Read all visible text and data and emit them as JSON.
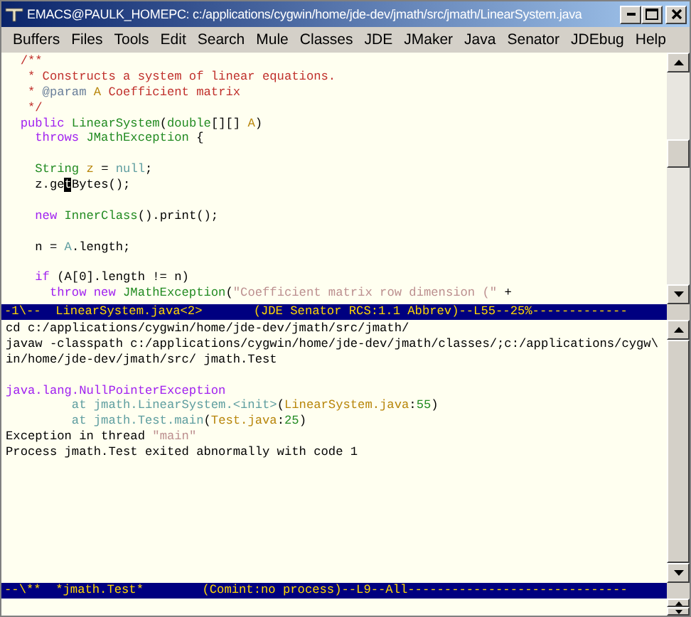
{
  "window": {
    "title": "EMACS@PAULK_HOMEPC: c:/applications/cygwin/home/jde-dev/jmath/src/jmath/LinearSystem.java"
  },
  "menu": [
    "Buffers",
    "Files",
    "Tools",
    "Edit",
    "Search",
    "Mule",
    "Classes",
    "JDE",
    "JMaker",
    "Java",
    "Senator",
    "JDEbug",
    "Help"
  ],
  "editor": {
    "lines": [
      {
        "kind": "code",
        "tokens": [
          {
            "text": "  /**",
            "kind": "comment"
          }
        ]
      },
      {
        "kind": "code",
        "tokens": [
          {
            "text": "   * Constructs a system of linear equations.",
            "kind": "comment"
          }
        ]
      },
      {
        "kind": "code",
        "tokens": [
          {
            "text": "   * ",
            "kind": "comment"
          },
          {
            "text": "@param ",
            "kind": "doctag"
          },
          {
            "text": "A",
            "kind": "variable"
          },
          {
            "text": " Coefficient matrix",
            "kind": "comment"
          }
        ]
      },
      {
        "kind": "code",
        "tokens": [
          {
            "text": "   */",
            "kind": "comment"
          }
        ]
      },
      {
        "kind": "code",
        "tokens": [
          {
            "text": "  public ",
            "kind": "keyword"
          },
          {
            "text": "LinearSystem",
            "kind": "type"
          },
          {
            "text": "(",
            "kind": "plain"
          },
          {
            "text": "double",
            "kind": "type"
          },
          {
            "text": "[][] ",
            "kind": "plain"
          },
          {
            "text": "A",
            "kind": "variable"
          },
          {
            "text": ")",
            "kind": "plain"
          }
        ]
      },
      {
        "kind": "code",
        "tokens": [
          {
            "text": "    throws ",
            "kind": "keyword"
          },
          {
            "text": "JMathException",
            "kind": "type"
          },
          {
            "text": " {",
            "kind": "plain"
          }
        ]
      },
      {
        "kind": "blank"
      },
      {
        "kind": "code",
        "tokens": [
          {
            "text": "    String ",
            "kind": "type"
          },
          {
            "text": "z",
            "kind": "variable"
          },
          {
            "text": " = ",
            "kind": "plain"
          },
          {
            "text": "null",
            "kind": "constant"
          },
          {
            "text": ";",
            "kind": "plain"
          }
        ]
      },
      {
        "kind": "code",
        "tokens": [
          {
            "text": "    z.ge",
            "kind": "plain"
          },
          {
            "text": "t",
            "kind": "cursor"
          },
          {
            "text": "Bytes();",
            "kind": "plain"
          }
        ]
      },
      {
        "kind": "blank"
      },
      {
        "kind": "code",
        "tokens": [
          {
            "text": "    new ",
            "kind": "keyword"
          },
          {
            "text": "InnerClass",
            "kind": "type"
          },
          {
            "text": "().print();",
            "kind": "plain"
          }
        ]
      },
      {
        "kind": "blank"
      },
      {
        "kind": "code",
        "tokens": [
          {
            "text": "    n = ",
            "kind": "plain"
          },
          {
            "text": "A",
            "kind": "constant"
          },
          {
            "text": ".length;",
            "kind": "plain"
          }
        ]
      },
      {
        "kind": "blank"
      },
      {
        "kind": "code",
        "tokens": [
          {
            "text": "    if ",
            "kind": "keyword"
          },
          {
            "text": "(A[0].length != n)",
            "kind": "plain"
          }
        ]
      },
      {
        "kind": "code",
        "tokens": [
          {
            "text": "      throw new ",
            "kind": "keyword"
          },
          {
            "text": "JMathException",
            "kind": "type"
          },
          {
            "text": "(",
            "kind": "plain"
          },
          {
            "text": "\"Coefficient matrix row dimension (\"",
            "kind": "string"
          },
          {
            "text": " +",
            "kind": "plain"
          }
        ]
      }
    ],
    "modeline": "-1\\--  LinearSystem.java<2>       (JDE Senator RCS:1.1 Abbrev)--L55--25%-------------"
  },
  "compilation": {
    "lines": [
      {
        "kind": "code",
        "tokens": [
          {
            "text": "cd c:/applications/cygwin/home/jde-dev/jmath/src/jmath/",
            "kind": "plain"
          }
        ]
      },
      {
        "kind": "code",
        "tokens": [
          {
            "text": "javaw -classpath c:/applications/cygwin/home/jde-dev/jmath/classes/;c:/applications/cygw\\",
            "kind": "plain"
          }
        ]
      },
      {
        "kind": "code",
        "tokens": [
          {
            "text": "in/home/jde-dev/jmath/src/ jmath.Test",
            "kind": "plain"
          }
        ]
      },
      {
        "kind": "blank"
      },
      {
        "kind": "code",
        "tokens": [
          {
            "text": "java.lang.NullPointerException",
            "kind": "keyword"
          }
        ]
      },
      {
        "kind": "code",
        "tokens": [
          {
            "text": "         at jmath.LinearSystem.<init>",
            "kind": "constant"
          },
          {
            "text": "(",
            "kind": "plain"
          },
          {
            "text": "LinearSystem.java",
            "kind": "variable"
          },
          {
            "text": ":",
            "kind": "plain"
          },
          {
            "text": "55",
            "kind": "type"
          },
          {
            "text": ")",
            "kind": "plain"
          }
        ]
      },
      {
        "kind": "code",
        "tokens": [
          {
            "text": "         at jmath.Test.main",
            "kind": "constant"
          },
          {
            "text": "(",
            "kind": "plain"
          },
          {
            "text": "Test.java",
            "kind": "variable"
          },
          {
            "text": ":",
            "kind": "plain"
          },
          {
            "text": "25",
            "kind": "type"
          },
          {
            "text": ")",
            "kind": "plain"
          }
        ]
      },
      {
        "kind": "code",
        "tokens": [
          {
            "text": "Exception in thread ",
            "kind": "plain"
          },
          {
            "text": "\"main\"",
            "kind": "string"
          }
        ]
      },
      {
        "kind": "code",
        "tokens": [
          {
            "text": "Process jmath.Test exited abnormally with code 1",
            "kind": "plain"
          }
        ]
      }
    ],
    "modeline": "--\\**  *jmath.Test*        (Comint:no process)--L9--All------------------------------"
  }
}
